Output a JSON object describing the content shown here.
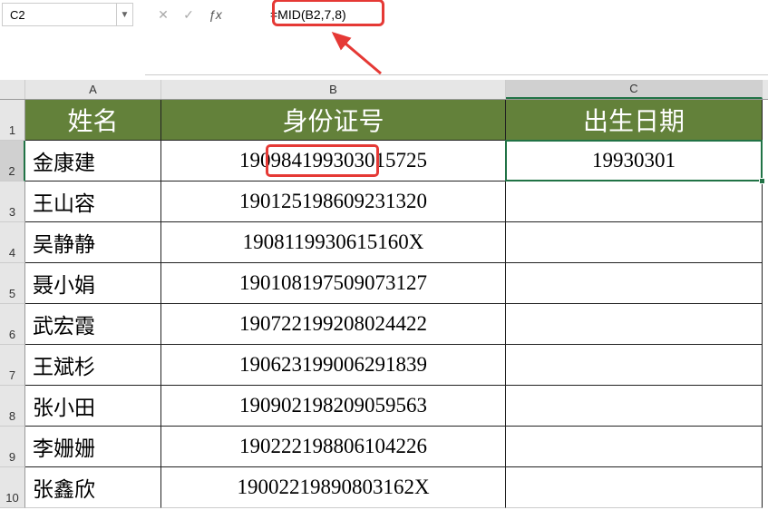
{
  "nameBox": {
    "value": "C2"
  },
  "formulaBar": {
    "formula": "=MID(B2,7,8)"
  },
  "columns": {
    "A": "A",
    "B": "B",
    "C": "C"
  },
  "headers": {
    "A": "姓名",
    "B": "身份证号",
    "C": "出生日期"
  },
  "rows": [
    {
      "num": "1"
    },
    {
      "num": "2",
      "A": "金康建",
      "B": "190984199303015725",
      "C": "19930301"
    },
    {
      "num": "3",
      "A": "王山容",
      "B": "190125198609231320",
      "C": ""
    },
    {
      "num": "4",
      "A": "吴静静",
      "B": "19081199306151​60X",
      "C": ""
    },
    {
      "num": "5",
      "A": "聂小娟",
      "B": "190108197509073127",
      "C": ""
    },
    {
      "num": "6",
      "A": "武宏霞",
      "B": "190722199208024422",
      "C": ""
    },
    {
      "num": "7",
      "A": "王斌杉",
      "B": "190623199006291839",
      "C": ""
    },
    {
      "num": "8",
      "A": "张小田",
      "B": "190902198209059563",
      "C": ""
    },
    {
      "num": "9",
      "A": "李姗姗",
      "B": "190222198806104226",
      "C": ""
    },
    {
      "num": "10",
      "A": "张鑫欣",
      "B": "19002219890803162X",
      "C": ""
    }
  ],
  "chart_data": {
    "type": "table",
    "title": "",
    "columns": [
      "姓名",
      "身份证号",
      "出生日期"
    ],
    "data": [
      [
        "金康建",
        "190984199303015725",
        "19930301"
      ],
      [
        "王山容",
        "190125198609231320",
        ""
      ],
      [
        "吴静静",
        "190811993061516​0X",
        ""
      ],
      [
        "聂小娟",
        "190108197509073127",
        ""
      ],
      [
        "武宏霞",
        "190722199208024422",
        ""
      ],
      [
        "王斌杉",
        "190623199006291839",
        ""
      ],
      [
        "张小田",
        "190902198209059563",
        ""
      ],
      [
        "李姗姗",
        "190222198806104226",
        ""
      ],
      [
        "张鑫欣",
        "19002219890803162X",
        ""
      ]
    ]
  }
}
